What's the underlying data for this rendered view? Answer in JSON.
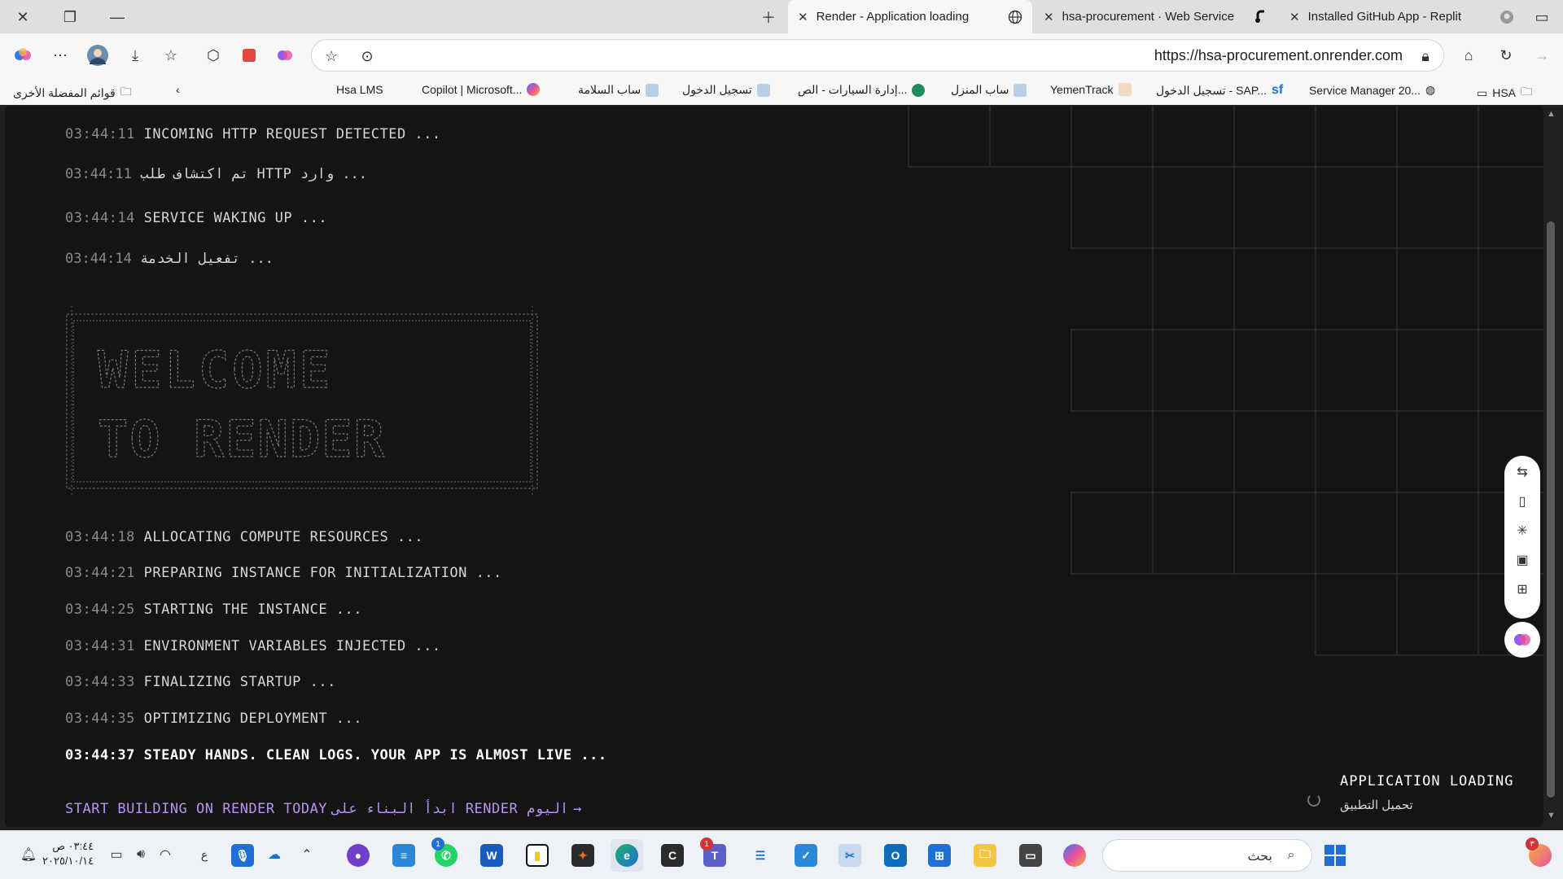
{
  "tabs": [
    {
      "label": "Render - Application loading",
      "active": true
    },
    {
      "label": "hsa-procurement · Web Service"
    },
    {
      "label": "Installed GitHub App - Replit"
    }
  ],
  "address": {
    "url": "https://hsa-procurement.onrender.com"
  },
  "favorites": {
    "other": "قوائم المفضلة الأخرى",
    "items": [
      "Hsa LMS",
      "Copilot | Microsoft...",
      "ساب السلامة",
      "تسجيل الدخول",
      "إدارة السيارات - الص...",
      "ساب المنزل",
      "YemenTrack",
      "تسجيل الدخول - SAP...",
      "Service Manager 20...",
      "HSA"
    ]
  },
  "logs": [
    {
      "time": "03:44:11",
      "text": "INCOMING HTTP REQUEST DETECTED ..."
    },
    {
      "time": "03:44:11",
      "text": "تم اكتشاف طلب HTTP وارد ..."
    },
    {
      "time": "03:44:14",
      "text": "SERVICE WAKING UP ..."
    },
    {
      "time": "03:44:14",
      "text": "تفعيل الخدمة ..."
    },
    {
      "time": "03:44:18",
      "text": "ALLOCATING COMPUTE RESOURCES ..."
    },
    {
      "time": "03:44:21",
      "text": "PREPARING INSTANCE FOR INITIALIZATION ..."
    },
    {
      "time": "03:44:25",
      "text": "STARTING THE INSTANCE ..."
    },
    {
      "time": "03:44:31",
      "text": "ENVIRONMENT VARIABLES INJECTED ..."
    },
    {
      "time": "03:44:33",
      "text": "FINALIZING STARTUP ..."
    },
    {
      "time": "03:44:35",
      "text": "OPTIMIZING DEPLOYMENT ..."
    },
    {
      "time": "03:44:37",
      "text": "STEADY HANDS. CLEAN LOGS. YOUR APP IS ALMOST LIVE ..."
    }
  ],
  "banner": {
    "line1": "WELCOME",
    "line2": "TO RENDER"
  },
  "cta": {
    "en": "START BUILDING ON RENDER TODAY",
    "ar": "ابدأ البناء على RENDER اليوم",
    "arrow": "→"
  },
  "loading": {
    "title": "APPLICATION LOADING",
    "subtitle": "تحميل التطبيق"
  },
  "taskbar": {
    "time": "٠٣:٤٤ ص",
    "date": "٢٠٢٥/١٠/١٤",
    "lang": "ع",
    "search_placeholder": "بحث",
    "teams_badge": "1",
    "whatsapp_badge": "1",
    "copilot_badge": "٣"
  },
  "colors": {
    "page_bg": "#141414",
    "accent": "#b794f6",
    "grid": "#3a3a3a"
  }
}
